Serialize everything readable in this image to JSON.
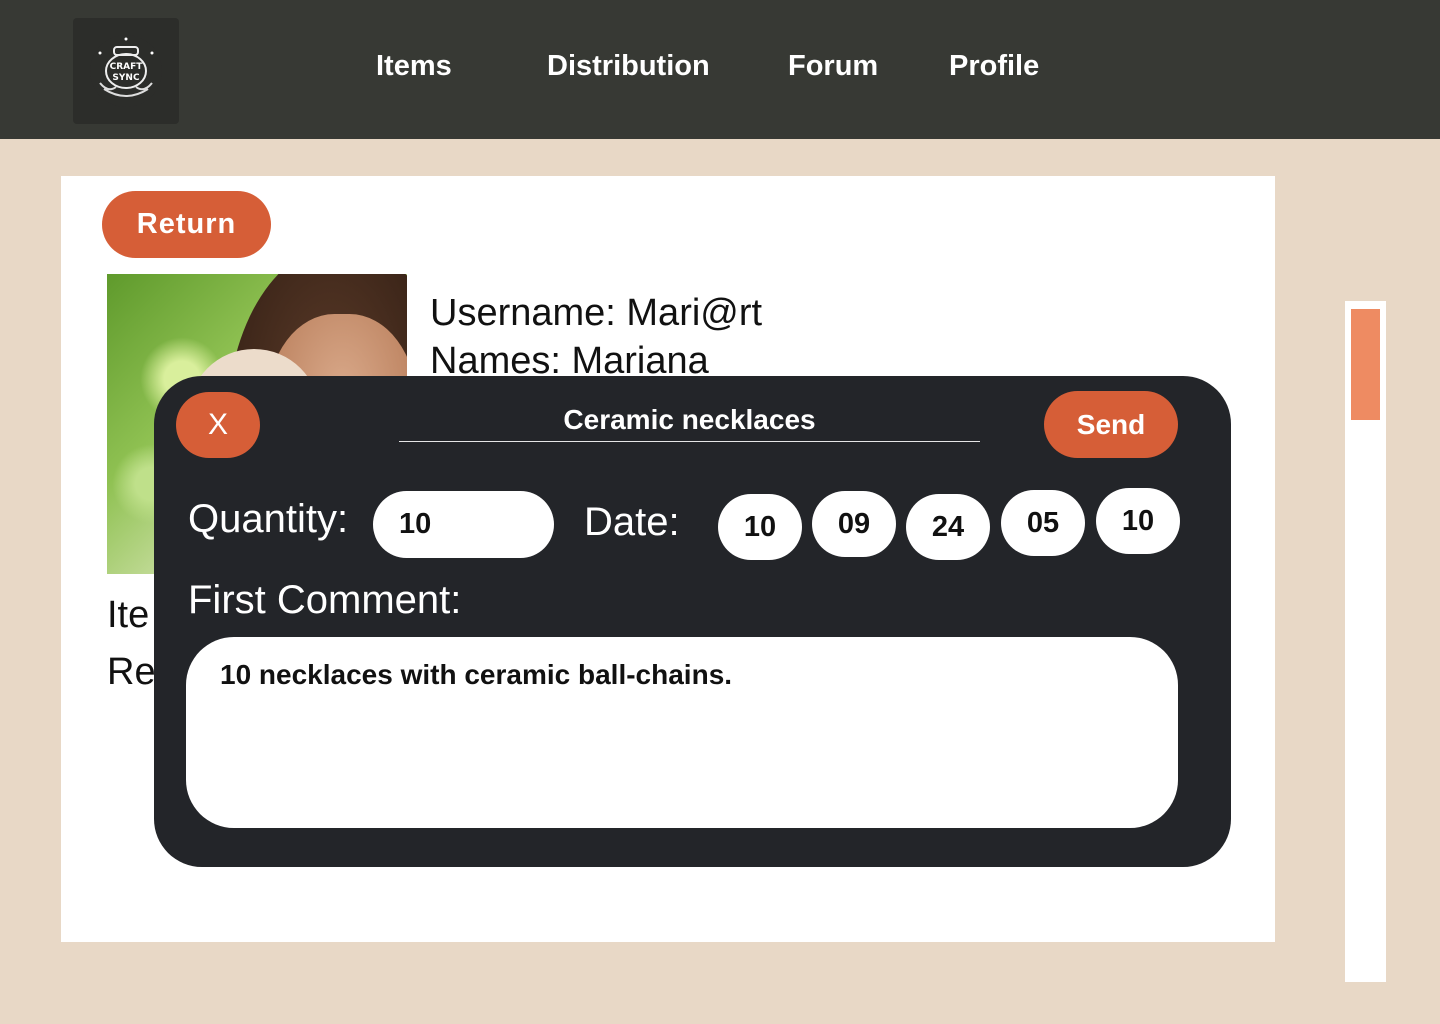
{
  "header": {
    "logo_text_top": "CRAFT",
    "logo_text_bottom": "SYNC",
    "nav": [
      {
        "label": "Items"
      },
      {
        "label": "Distribution"
      },
      {
        "label": "Forum"
      },
      {
        "label": "Profile"
      }
    ]
  },
  "page": {
    "return_label": "Return",
    "username_line": "Username: Mari@rt",
    "names_line": "Names: Mariana",
    "side_label_1": "Ite",
    "side_label_2": "Re"
  },
  "modal": {
    "close_label": "X",
    "title": "Ceramic necklaces",
    "send_label": "Send",
    "quantity_label": "Quantity:",
    "quantity_value": "10",
    "date_label": "Date:",
    "date_fields": [
      "10",
      "09",
      "24",
      "05",
      "10"
    ],
    "comment_label": "First Comment:",
    "comment_value": "10 necklaces with ceramic ball-chains."
  },
  "colors": {
    "header_bg": "#373934",
    "page_bg": "#e8d8c6",
    "accent": "#d65e37",
    "modal_bg": "#232529",
    "scroll_thumb": "#ee8b62"
  }
}
